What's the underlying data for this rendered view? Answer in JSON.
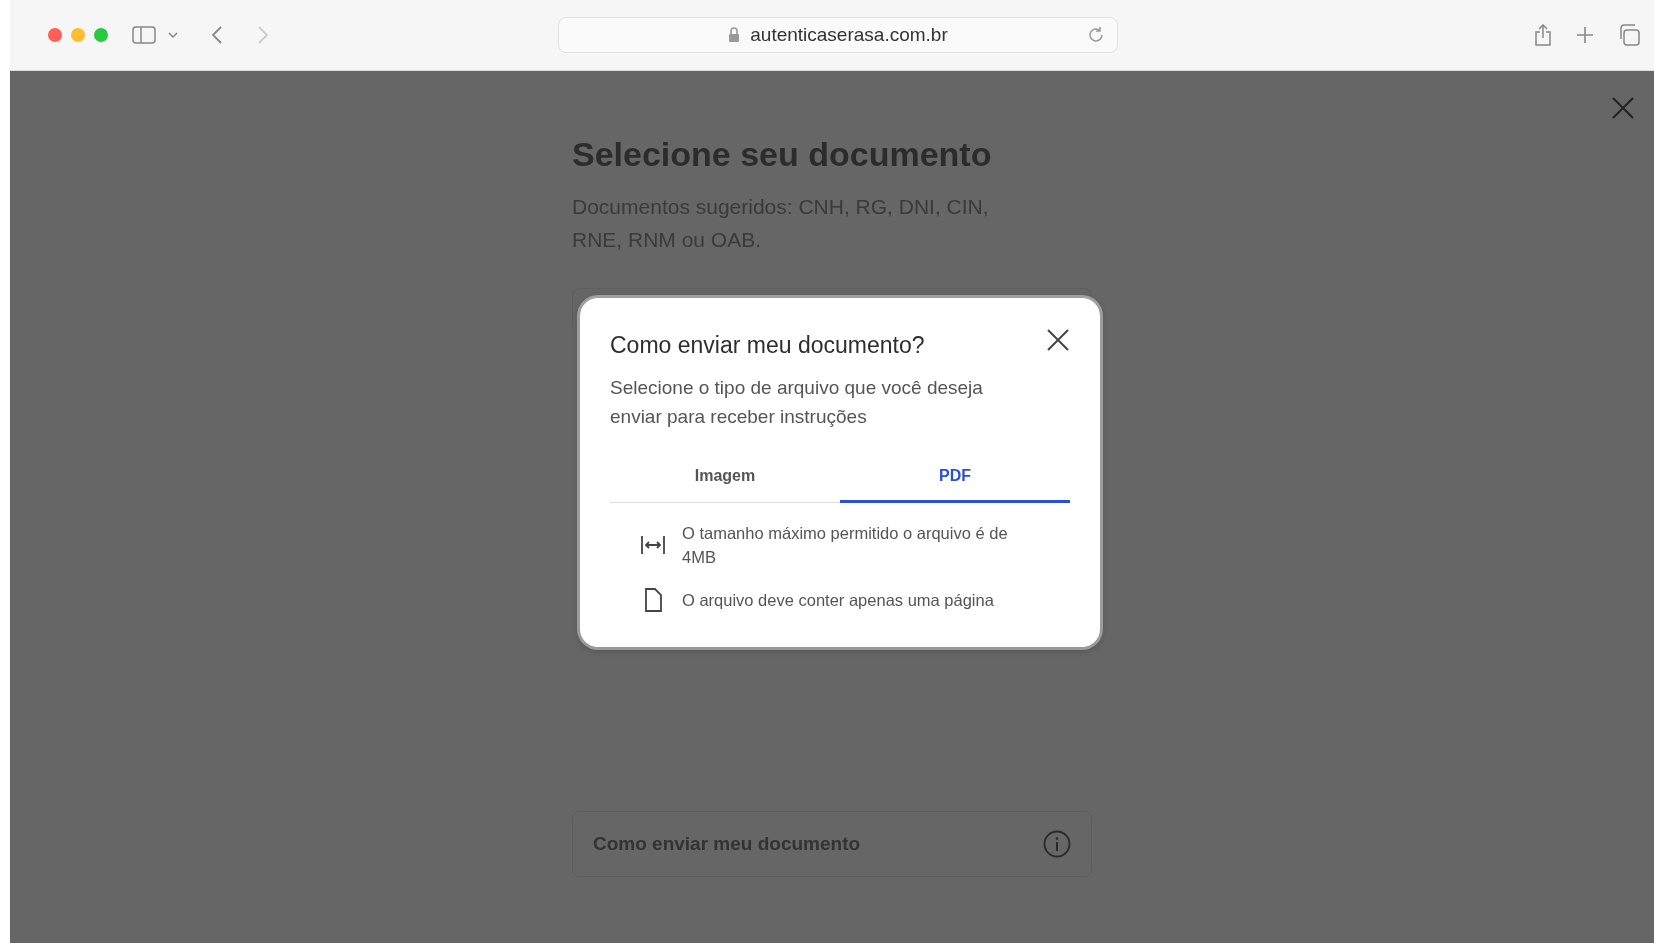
{
  "browser": {
    "url": "autenticaserasa.com.br"
  },
  "page": {
    "title": "Selecione seu documento",
    "subtitle": "Documentos sugeridos: CNH, RG, DNI, CIN, RNE, RNM ou OAB.",
    "help_card": {
      "label": "Como enviar meu documento"
    }
  },
  "modal": {
    "title": "Como enviar meu documento?",
    "subtitle": "Selecione o tipo de arquivo que você deseja enviar para receber instruções",
    "tabs": [
      {
        "label": "Imagem",
        "selected": false
      },
      {
        "label": "PDF",
        "selected": true
      }
    ],
    "items": [
      {
        "kind": "size",
        "text": "O tamanho máximo permitido o arquivo é de 4MB"
      },
      {
        "kind": "page",
        "text": "O arquivo deve conter apenas uma página"
      }
    ]
  }
}
